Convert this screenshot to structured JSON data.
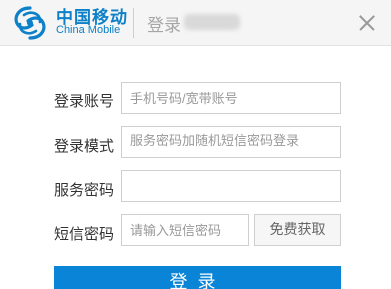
{
  "header": {
    "brand_cn": "中国移动",
    "brand_en": "China Mobile",
    "title": "登录",
    "logo_icon": "china-mobile-logo-icon",
    "close_icon": "close-icon",
    "brand_color": "#0c80c8"
  },
  "form": {
    "account_label": "登录账号",
    "account_placeholder": "手机号码/宽带账号",
    "mode_label": "登录模式",
    "mode_value": "服务密码加随机短信密码登录",
    "password_label": "服务密码",
    "password_placeholder": "",
    "sms_label": "短信密码",
    "sms_placeholder": "请输入短信密码",
    "sms_button": "免费获取"
  },
  "login_button": "登录",
  "accent_color": "#0a84d6"
}
